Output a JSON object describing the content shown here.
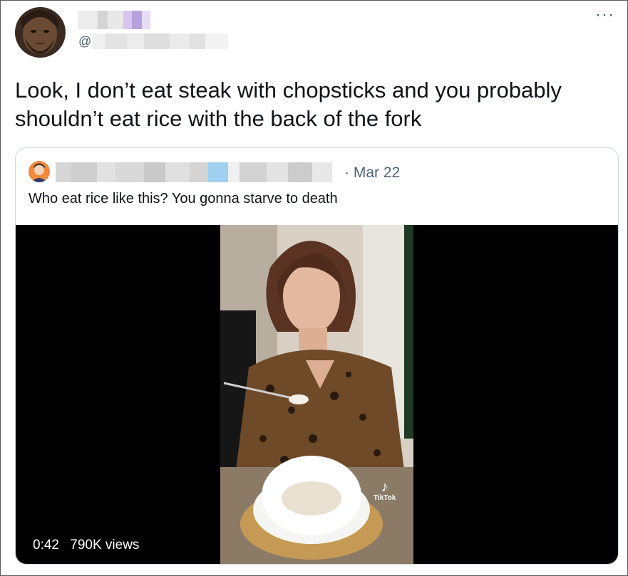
{
  "author": {
    "handle_prefix": "@"
  },
  "tweet": {
    "text": "Look, I don’t eat steak with chopsticks and you probably shouldn’t eat rice with the back of the fork",
    "more_icon": "more-icon"
  },
  "quoted_tweet": {
    "date": "· Mar 22",
    "text": "Who eat rice like this? You gonna starve to death"
  },
  "video": {
    "duration": "0:42",
    "views": "790K views",
    "watermark": "TikTok"
  }
}
